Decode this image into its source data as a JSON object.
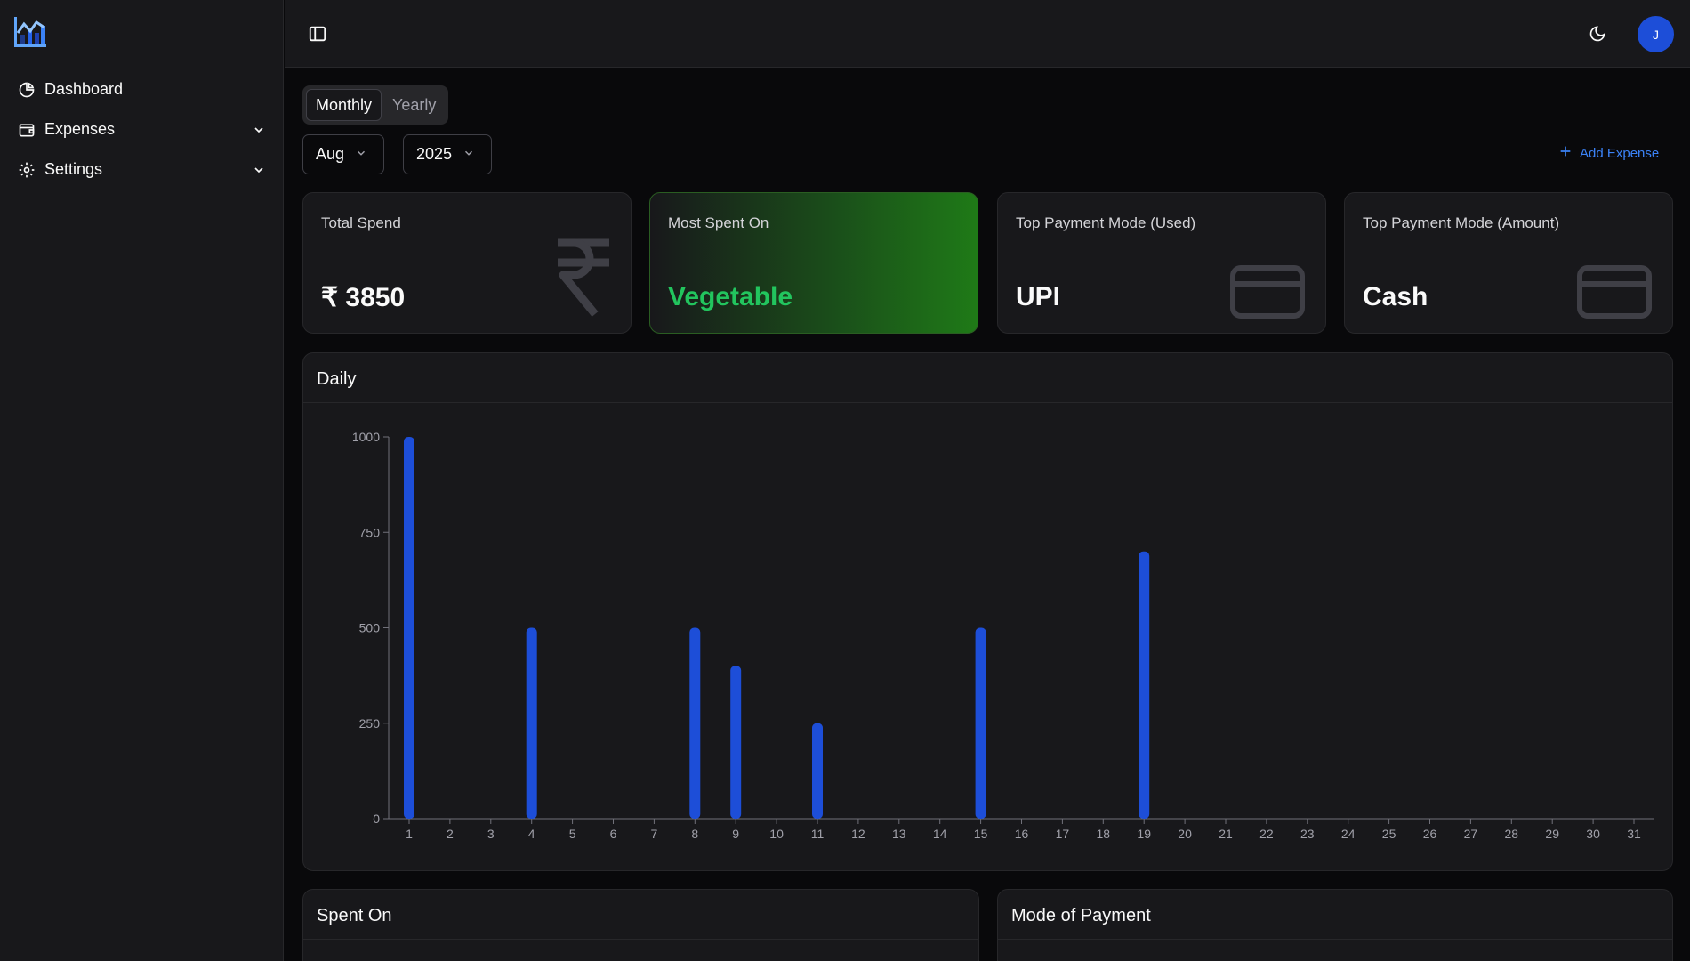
{
  "sidebar": {
    "items": [
      {
        "label": "Dashboard"
      },
      {
        "label": "Expenses"
      },
      {
        "label": "Settings"
      }
    ]
  },
  "topbar": {
    "avatar_initial": "J"
  },
  "period_toggle": {
    "options": [
      "Monthly",
      "Yearly"
    ],
    "selected": "Monthly"
  },
  "filters": {
    "month": "Aug",
    "year": "2025"
  },
  "add_expense_label": "Add Expense",
  "cards": [
    {
      "label": "Total Spend",
      "value": "₹ 3850"
    },
    {
      "label": "Most Spent On",
      "value": "Vegetable"
    },
    {
      "label": "Top Payment Mode (Used)",
      "value": "UPI"
    },
    {
      "label": "Top Payment Mode (Amount)",
      "value": "Cash"
    }
  ],
  "colors": {
    "accent": "#1d4ed8",
    "bar": "#1d4ed8",
    "highlight_green": "#22c55e",
    "link_blue": "#3b82f6"
  },
  "daily_panel": {
    "title": "Daily"
  },
  "chart_data": {
    "type": "bar",
    "title": "Daily",
    "xlabel": "",
    "ylabel": "",
    "ylim": [
      0,
      1000
    ],
    "yticks": [
      0,
      250,
      500,
      750,
      1000
    ],
    "categories": [
      "1",
      "2",
      "3",
      "4",
      "5",
      "6",
      "7",
      "8",
      "9",
      "10",
      "11",
      "12",
      "13",
      "14",
      "15",
      "16",
      "17",
      "18",
      "19",
      "20",
      "21",
      "22",
      "23",
      "24",
      "25",
      "26",
      "27",
      "28",
      "29",
      "30",
      "31"
    ],
    "values": [
      1000,
      0,
      0,
      500,
      0,
      0,
      0,
      500,
      400,
      0,
      250,
      0,
      0,
      0,
      500,
      0,
      0,
      0,
      700,
      0,
      0,
      0,
      0,
      0,
      0,
      0,
      0,
      0,
      0,
      0,
      0
    ],
    "grid": false,
    "legend": "none"
  },
  "bottom_panels": {
    "spent_on_title": "Spent On",
    "mode_of_payment_title": "Mode of Payment"
  }
}
